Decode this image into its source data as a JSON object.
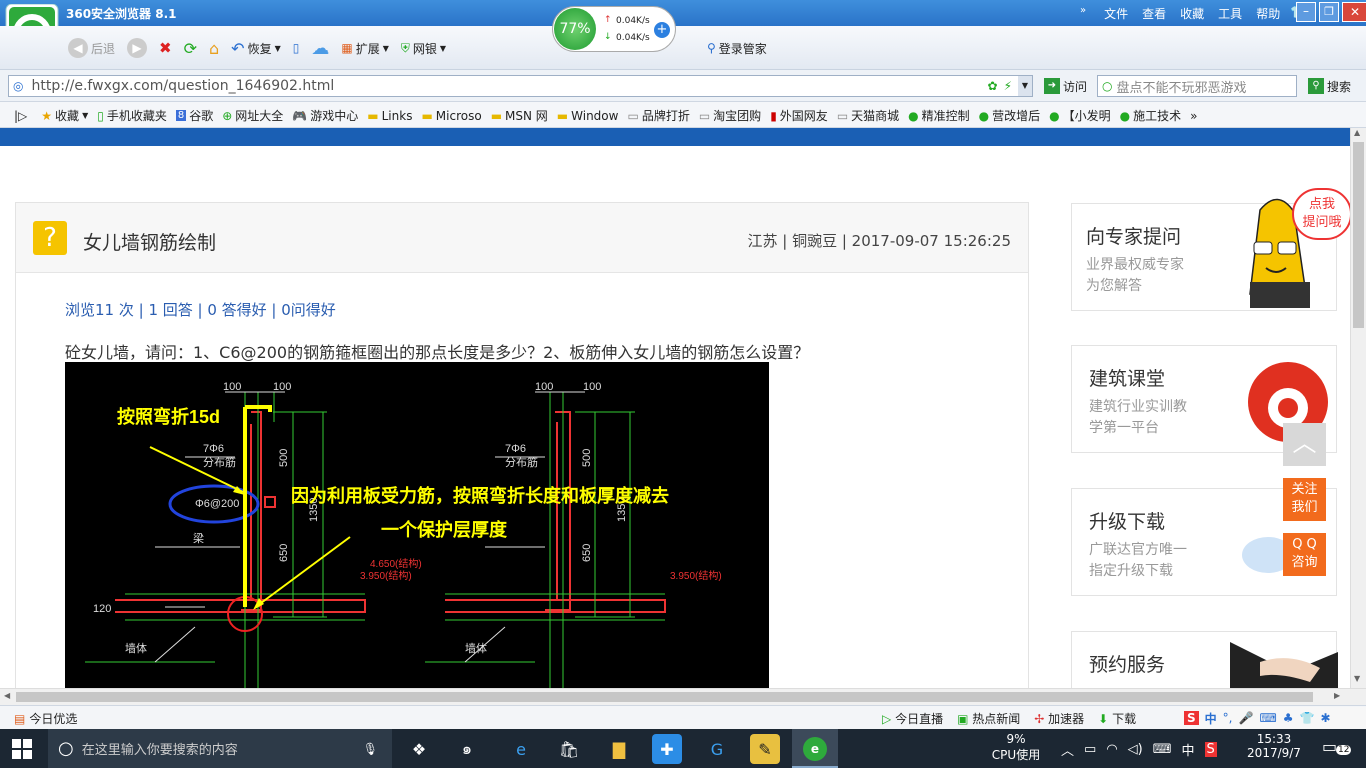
{
  "browser": {
    "title": "360安全浏览器 8.1",
    "menu": [
      "文件",
      "查看",
      "收藏",
      "工具",
      "帮助"
    ],
    "speed": {
      "percent": "77%",
      "up": "0.04K/s",
      "down": "0.04K/s"
    },
    "toolbar": {
      "back": "后退",
      "restore": "恢复",
      "extend": "扩展",
      "bank": "网银",
      "login_manager": "登录管家"
    },
    "address": {
      "url": "http://e.fwxgx.com/question_1646902.html",
      "visit": "访问",
      "search_placeholder": "盘点不能不玩邪恶游戏",
      "search_btn": "搜索"
    },
    "favorites": [
      "收藏",
      "手机收藏夹",
      "谷歌",
      "网址大全",
      "游戏中心",
      "Links",
      "Microso",
      "MSN 网",
      "Window",
      "品牌打折",
      "淘宝团购",
      "外国网友",
      "天猫商城",
      "精准控制",
      "营改增后",
      "【小发明",
      "施工技术"
    ]
  },
  "question": {
    "title": "女儿墙钢筋绘制",
    "meta": "江苏 | 铜豌豆 | 2017-09-07 15:26:25",
    "stats": "浏览11 次 | 1 回答 | 0 答得好 | 0问得好",
    "body": "砼女儿墙，请问：1、C6@200的钢筋箍框圈出的那点长度是多少？2、板筋伸入女儿墙的钢筋怎么设置？",
    "image": {
      "annotation1": "按照弯折15d",
      "annotation2": "因为利用板受力筋，按照弯折长度和板厚度减去",
      "annotation3": "一个保护层厚度",
      "dim_100a": "100",
      "dim_100b": "100",
      "dim_100c": "100",
      "dim_100d": "100",
      "dim_500": "500",
      "dim_650": "650",
      "dim_1350": "1350",
      "dim_120": "120",
      "label_phi6": "7Φ6",
      "label_dist": "分布筋",
      "label_c6": "Φ6@200",
      "label_elev1": "4.650(结构)",
      "label_elev2": "3.950(结构)",
      "label_elev3": "3.950(结构)",
      "label_beam": "梁",
      "label_wall": "墙体"
    }
  },
  "sidebar": {
    "bubble": "点我\n提问哦",
    "cards": [
      {
        "title": "向专家提问",
        "sub1": "业界最权威专家",
        "sub2": "为您解答"
      },
      {
        "title": "建筑课堂",
        "sub1": "建筑行业实训教",
        "sub2": "学第一平台"
      },
      {
        "title": "升级下载",
        "sub1": "广联达官方唯一",
        "sub2": "指定升级下载"
      },
      {
        "title": "预约服务",
        "sub1": "",
        "sub2": ""
      }
    ],
    "float": {
      "follow1": "关注",
      "follow2": "我们",
      "qq1": "Q Q",
      "qq2": "咨询"
    }
  },
  "statusbar": {
    "left": "今日优选",
    "items": [
      "今日直播",
      "热点新闻",
      "加速器",
      "下载"
    ]
  },
  "taskbar": {
    "search_placeholder": "在这里输入你要搜索的内容",
    "cpu_pct": "9%",
    "cpu_label": "CPU使用",
    "ime": "中",
    "time": "15:33",
    "date": "2017/9/7",
    "notif": "12"
  }
}
